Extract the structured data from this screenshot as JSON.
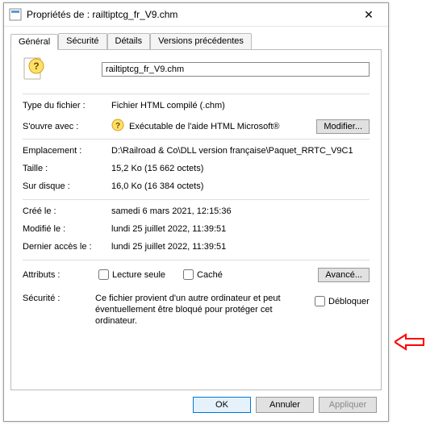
{
  "window": {
    "title_prefix": "Propriétés de : ",
    "filename": "railtiptcg_fr_V9.chm",
    "close": "✕"
  },
  "tabs": {
    "general": "Général",
    "security": "Sécurité",
    "details": "Détails",
    "previous": "Versions précédentes"
  },
  "fields": {
    "filename": "railtiptcg_fr_V9.chm",
    "filetype_label": "Type du fichier :",
    "filetype_value": "Fichier HTML compilé (.chm)",
    "openwith_label": "S'ouvre avec :",
    "openwith_value": "Exécutable de l'aide HTML Microsoft®",
    "modify_btn": "Modifier...",
    "location_label": "Emplacement :",
    "location_value": "D:\\Railroad & Co\\DLL version française\\Paquet_RRTC_V9C1",
    "size_label": "Taille :",
    "size_value": "15,2 Ko (15 662 octets)",
    "sizeondisk_label": "Sur disque :",
    "sizeondisk_value": "16,0 Ko (16 384 octets)",
    "created_label": "Créé le :",
    "created_value": "samedi 6 mars 2021, 12:15:36",
    "modified_label": "Modifié le :",
    "modified_value": "lundi 25 juillet 2022, 11:39:51",
    "accessed_label": "Dernier accès le :",
    "accessed_value": "lundi 25 juillet 2022, 11:39:51",
    "attributes_label": "Attributs :",
    "readonly_label": "Lecture seule",
    "hidden_label": "Caché",
    "advanced_btn": "Avancé...",
    "security_label": "Sécurité :",
    "security_text": "Ce fichier provient d'un autre ordinateur et peut éventuellement être bloqué pour protéger cet ordinateur.",
    "unblock_label": "Débloquer"
  },
  "buttons": {
    "ok": "OK",
    "cancel": "Annuler",
    "apply": "Appliquer"
  },
  "icons": {
    "help": "?",
    "question": "❓"
  }
}
